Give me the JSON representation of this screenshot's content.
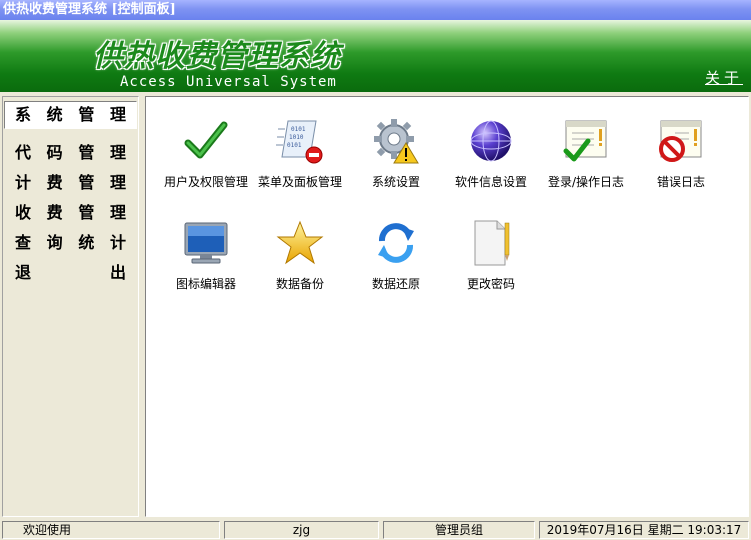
{
  "window": {
    "title": "供热收费管理系统 [控制面板]"
  },
  "banner": {
    "title": "供热收费管理系统",
    "subtitle": "Access Universal System",
    "about_label": "关于"
  },
  "sidebar": {
    "items": [
      {
        "label": "系统管理",
        "chars": [
          "系",
          "统",
          "管",
          "理"
        ],
        "selected": true
      },
      {
        "label": "代码管理",
        "chars": [
          "代",
          "码",
          "管",
          "理"
        ],
        "selected": false
      },
      {
        "label": "计费管理",
        "chars": [
          "计",
          "费",
          "管",
          "理"
        ],
        "selected": false
      },
      {
        "label": "收费管理",
        "chars": [
          "收",
          "费",
          "管",
          "理"
        ],
        "selected": false
      },
      {
        "label": "查询统计",
        "chars": [
          "查",
          "询",
          "统",
          "计"
        ],
        "selected": false
      },
      {
        "label": "退出",
        "chars": [
          "退",
          "出"
        ],
        "selected": false
      }
    ]
  },
  "panel": {
    "tiles": [
      {
        "label": "用户及权限管理",
        "icon": "checkmark-icon"
      },
      {
        "label": "菜单及面板管理",
        "icon": "binary-document-icon"
      },
      {
        "label": "系统设置",
        "icon": "gear-warning-icon"
      },
      {
        "label": "软件信息设置",
        "icon": "globe-icon"
      },
      {
        "label": "登录/操作日志",
        "icon": "log-check-icon"
      },
      {
        "label": "错误日志",
        "icon": "error-log-icon"
      },
      {
        "label": "图标编辑器",
        "icon": "monitor-icon"
      },
      {
        "label": "数据备份",
        "icon": "star-icon"
      },
      {
        "label": "数据还原",
        "icon": "refresh-icon"
      },
      {
        "label": "更改密码",
        "icon": "document-pencil-icon"
      }
    ]
  },
  "status": {
    "welcome": "欢迎使用",
    "user": "zjg",
    "group": "管理员组",
    "datetime": "2019年07月16日 星期二 19:03:17"
  },
  "colors": {
    "titlebar": "#7f93f2",
    "banner_green": "#0f7a12",
    "window_bg": "#ece9d8"
  }
}
